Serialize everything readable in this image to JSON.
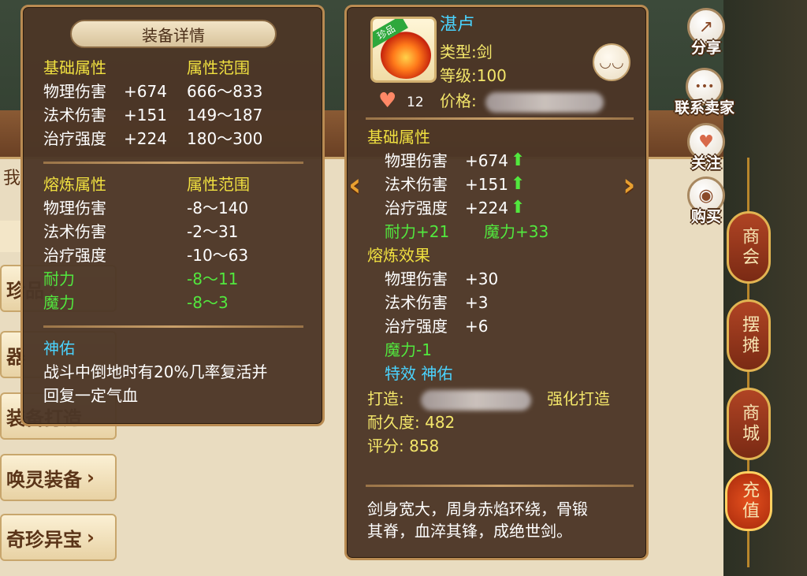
{
  "background": {
    "side_buttons": [
      {
        "label": "珍品",
        "chev": "›"
      },
      {
        "label": "器",
        "chev": ""
      },
      {
        "label": "装备打造",
        "chev": ""
      },
      {
        "label": "唤灵装备",
        "chev": "›"
      },
      {
        "label": "奇珍异宝",
        "chev": "›"
      }
    ],
    "search_prefix": "我",
    "right_tabs": [
      "商会",
      "摆摊",
      "商城",
      "充值"
    ]
  },
  "actions": [
    {
      "label": "分享",
      "icon": "share-icon",
      "glyph": "↗"
    },
    {
      "label": "联系卖家",
      "icon": "chat-icon",
      "glyph": "•••"
    },
    {
      "label": "关注",
      "icon": "heart-icon",
      "glyph": "♥"
    },
    {
      "label": "购买",
      "icon": "buy-icon",
      "glyph": "◉"
    }
  ],
  "detail": {
    "title": "装备详情",
    "base_header": "基础属性",
    "range_header": "属性范围",
    "base_rows": [
      {
        "name": "物理伤害",
        "value": "+674",
        "range": "666～833"
      },
      {
        "name": "法术伤害",
        "value": "+151",
        "range": "149～187"
      },
      {
        "name": "治疗强度",
        "value": "+224",
        "range": "180～300"
      }
    ],
    "smelt_header": "熔炼属性",
    "smelt_range_header": "属性范围",
    "smelt_rows": [
      {
        "name": "物理伤害",
        "range": "-8～140"
      },
      {
        "name": "法术伤害",
        "range": "-2～31"
      },
      {
        "name": "治疗强度",
        "range": "-10～63"
      },
      {
        "name": "耐力",
        "range": "-8～11"
      },
      {
        "name": "魔力",
        "range": "-8～3"
      }
    ],
    "blessing_title": "神佑",
    "blessing_desc_1": "战斗中倒地时有20%几率复活并",
    "blessing_desc_2": "回复一定气血"
  },
  "item": {
    "name": "湛卢",
    "ribbon": "珍品",
    "type": "类型:剑",
    "level": "等级:100",
    "likes": "12",
    "price_label": "价格:",
    "base_header": "基础属性",
    "base_rows": [
      {
        "name": "物理伤害",
        "value": "+674"
      },
      {
        "name": "法术伤害",
        "value": "+151"
      },
      {
        "name": "治疗强度",
        "value": "+224"
      }
    ],
    "stamina": "耐力+21",
    "mana": "魔力+33",
    "smelt_header": "熔炼效果",
    "smelt_rows": [
      {
        "name": "物理伤害",
        "value": "+30"
      },
      {
        "name": "法术伤害",
        "value": "+3"
      },
      {
        "name": "治疗强度",
        "value": "+6"
      }
    ],
    "smelt_mana": "魔力-1",
    "special": "特效  神佑",
    "forge_label": "打造:",
    "forge_enhance": "强化打造",
    "durability": "耐久度: 482",
    "score": "评分: 858",
    "desc_1": "剑身宽大，周身赤焰环绕，骨锻",
    "desc_2": "其脊，血淬其锋，成绝世剑。"
  },
  "colors": {
    "panel": "#4c3626",
    "yellow": "#f0e040",
    "green": "#52e83e",
    "cyan": "#4ad4ff"
  }
}
